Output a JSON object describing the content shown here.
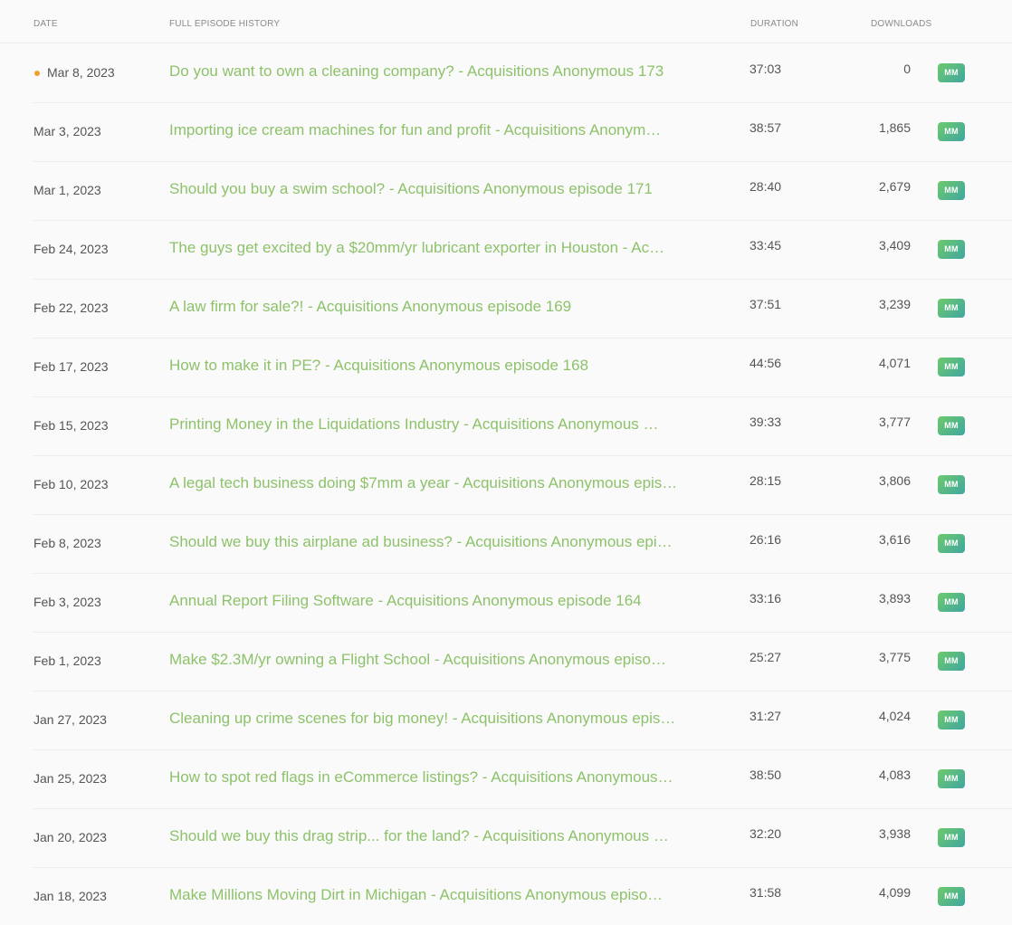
{
  "header": {
    "date": "DATE",
    "title": "FULL EPISODE HISTORY",
    "duration": "DURATION",
    "downloads": "DOWNLOADS"
  },
  "badge_label": "MM",
  "colors": {
    "title_link": "#8dc26a",
    "new_dot": "#f0a030",
    "badge_start": "#6ec96c",
    "badge_end": "#3fa7a0"
  },
  "episodes": [
    {
      "date": "Mar 8, 2023",
      "title": "Do you want to own a cleaning company? - Acquisitions Anonymous 173",
      "duration": "37:03",
      "downloads": "0",
      "is_new": true
    },
    {
      "date": "Mar 3, 2023",
      "title": "Importing ice cream machines for fun and profit - Acquisitions Anonym…",
      "duration": "38:57",
      "downloads": "1,865",
      "is_new": false
    },
    {
      "date": "Mar 1, 2023",
      "title": "Should you buy a swim school? - Acquisitions Anonymous episode 171",
      "duration": "28:40",
      "downloads": "2,679",
      "is_new": false
    },
    {
      "date": "Feb 24, 2023",
      "title": "The guys get excited by a $20mm/yr lubricant exporter in Houston - Ac…",
      "duration": "33:45",
      "downloads": "3,409",
      "is_new": false
    },
    {
      "date": "Feb 22, 2023",
      "title": "A law firm for sale?! - Acquisitions Anonymous episode 169",
      "duration": "37:51",
      "downloads": "3,239",
      "is_new": false
    },
    {
      "date": "Feb 17, 2023",
      "title": "How to make it in PE? - Acquisitions Anonymous episode 168",
      "duration": "44:56",
      "downloads": "4,071",
      "is_new": false
    },
    {
      "date": "Feb 15, 2023",
      "title": "Printing Money in the Liquidations Industry - Acquisitions Anonymous …",
      "duration": "39:33",
      "downloads": "3,777",
      "is_new": false
    },
    {
      "date": "Feb 10, 2023",
      "title": "A legal tech business doing $7mm a year - Acquisitions Anonymous epis…",
      "duration": "28:15",
      "downloads": "3,806",
      "is_new": false
    },
    {
      "date": "Feb 8, 2023",
      "title": "Should we buy this airplane ad business? - Acquisitions Anonymous epi…",
      "duration": "26:16",
      "downloads": "3,616",
      "is_new": false
    },
    {
      "date": "Feb 3, 2023",
      "title": "Annual Report Filing Software - Acquisitions Anonymous episode 164",
      "duration": "33:16",
      "downloads": "3,893",
      "is_new": false
    },
    {
      "date": "Feb 1, 2023",
      "title": "Make $2.3M/yr owning a Flight School - Acquisitions Anonymous episo…",
      "duration": "25:27",
      "downloads": "3,775",
      "is_new": false
    },
    {
      "date": "Jan 27, 2023",
      "title": "Cleaning up crime scenes for big money! - Acquisitions Anonymous epis…",
      "duration": "31:27",
      "downloads": "4,024",
      "is_new": false
    },
    {
      "date": "Jan 25, 2023",
      "title": "How to spot red flags in eCommerce listings? - Acquisitions Anonymous…",
      "duration": "38:50",
      "downloads": "4,083",
      "is_new": false
    },
    {
      "date": "Jan 20, 2023",
      "title": "Should we buy this drag strip... for the land? - Acquisitions Anonymous …",
      "duration": "32:20",
      "downloads": "3,938",
      "is_new": false
    },
    {
      "date": "Jan 18, 2023",
      "title": "Make Millions Moving Dirt in Michigan - Acquisitions Anonymous episo…",
      "duration": "31:58",
      "downloads": "4,099",
      "is_new": false
    }
  ]
}
